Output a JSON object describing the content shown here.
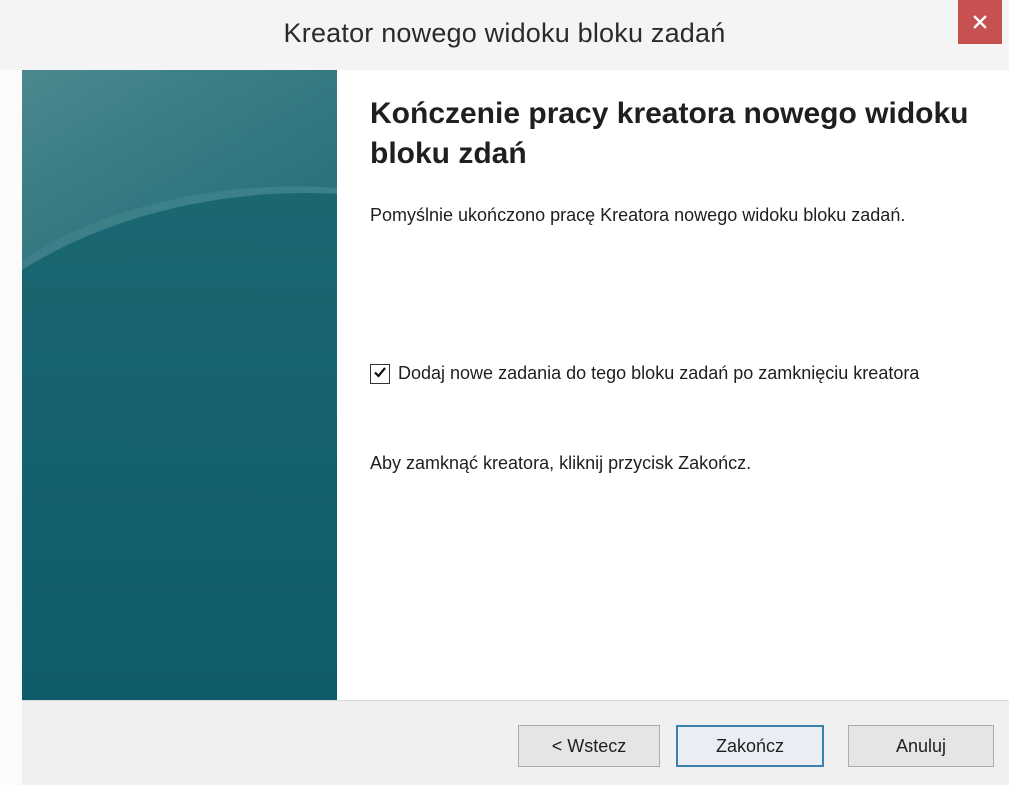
{
  "window": {
    "title": "Kreator nowego widoku bloku zadań",
    "close_icon": "close-icon"
  },
  "content": {
    "heading": "Kończenie pracy kreatora nowego widoku bloku zdań",
    "description": "Pomyślnie ukończono pracę Kreatora nowego widoku bloku zadań.",
    "checkbox": {
      "label": "Dodaj nowe zadania do tego bloku zadań po zamknięciu kreatora",
      "checked": true
    },
    "closing_note": "Aby zamknąć kreatora, kliknij przycisk Zakończ."
  },
  "buttons": {
    "back": "< Wstecz",
    "finish": "Zakończ",
    "cancel": "Anuluj"
  },
  "colors": {
    "close_button": "#c75050",
    "banner": "#14606c",
    "default_button_border": "#3c7fb1"
  }
}
